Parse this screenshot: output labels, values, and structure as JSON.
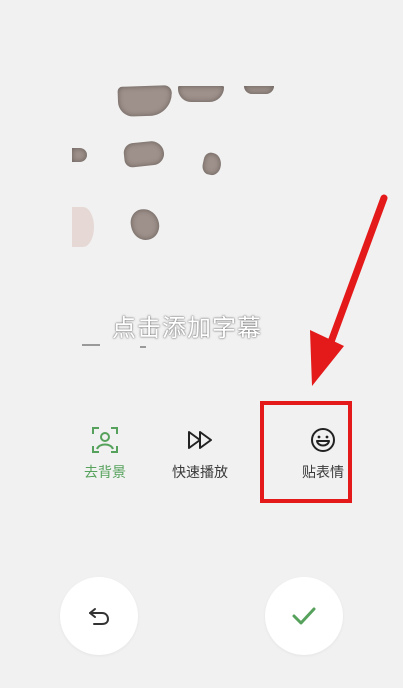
{
  "preview": {
    "caption_hint": "点击添加字幕"
  },
  "toolbar": {
    "items": [
      {
        "label": "去背景",
        "icon": "portrait-frame-icon",
        "active": true
      },
      {
        "label": "快速播放",
        "icon": "fast-forward-icon",
        "active": false
      },
      {
        "label": "贴表情",
        "icon": "smile-icon",
        "active": false
      }
    ]
  },
  "bottom": {
    "undo_icon": "undo-icon",
    "confirm_icon": "check-icon"
  },
  "colors": {
    "accent": "#56a25c",
    "highlight": "#e41919",
    "background": "#f1f1f1"
  }
}
